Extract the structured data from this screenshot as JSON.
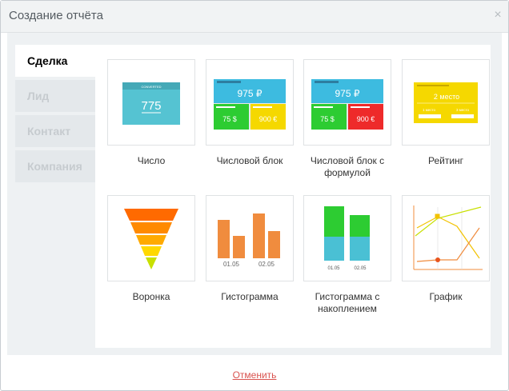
{
  "dialog": {
    "title": "Создание отчёта",
    "close_glyph": "×"
  },
  "tabs": [
    {
      "label": "Сделка"
    },
    {
      "label": "Лид"
    },
    {
      "label": "Контакт"
    },
    {
      "label": "Компания"
    }
  ],
  "tiles": [
    {
      "label": "Число",
      "preview": {
        "value": "775",
        "header": "CONVERTED"
      }
    },
    {
      "label": "Числовой блок",
      "preview": {
        "top_value": "975 ₽",
        "left_value": "75 $",
        "right_value": "900 €"
      }
    },
    {
      "label": "Числовой блок с формулой",
      "preview": {
        "top_value": "975 ₽",
        "left_value": "75 $",
        "right_value": "900 €"
      }
    },
    {
      "label": "Рейтинг",
      "preview": {
        "headline": "2 место",
        "left_place": "1 место",
        "right_place": "3 место"
      }
    },
    {
      "label": "Воронка",
      "preview": {}
    },
    {
      "label": "Гистограмма",
      "preview": {
        "x1": "01.05",
        "x2": "02.05"
      }
    },
    {
      "label": "Гистограмма с накоплением",
      "preview": {
        "x1": "01.05",
        "x2": "02.05"
      }
    },
    {
      "label": "График",
      "preview": {}
    }
  ],
  "footer": {
    "cancel_label": "Отменить"
  },
  "colors": {
    "accent_teal": "#55c3d2",
    "accent_green": "#2dcc32",
    "accent_yellow": "#f5d800",
    "accent_red": "#ee2a2a",
    "accent_blue": "#3dbbe0",
    "accent_orange": "#f08c3e",
    "cancel_red": "#d9534f"
  }
}
